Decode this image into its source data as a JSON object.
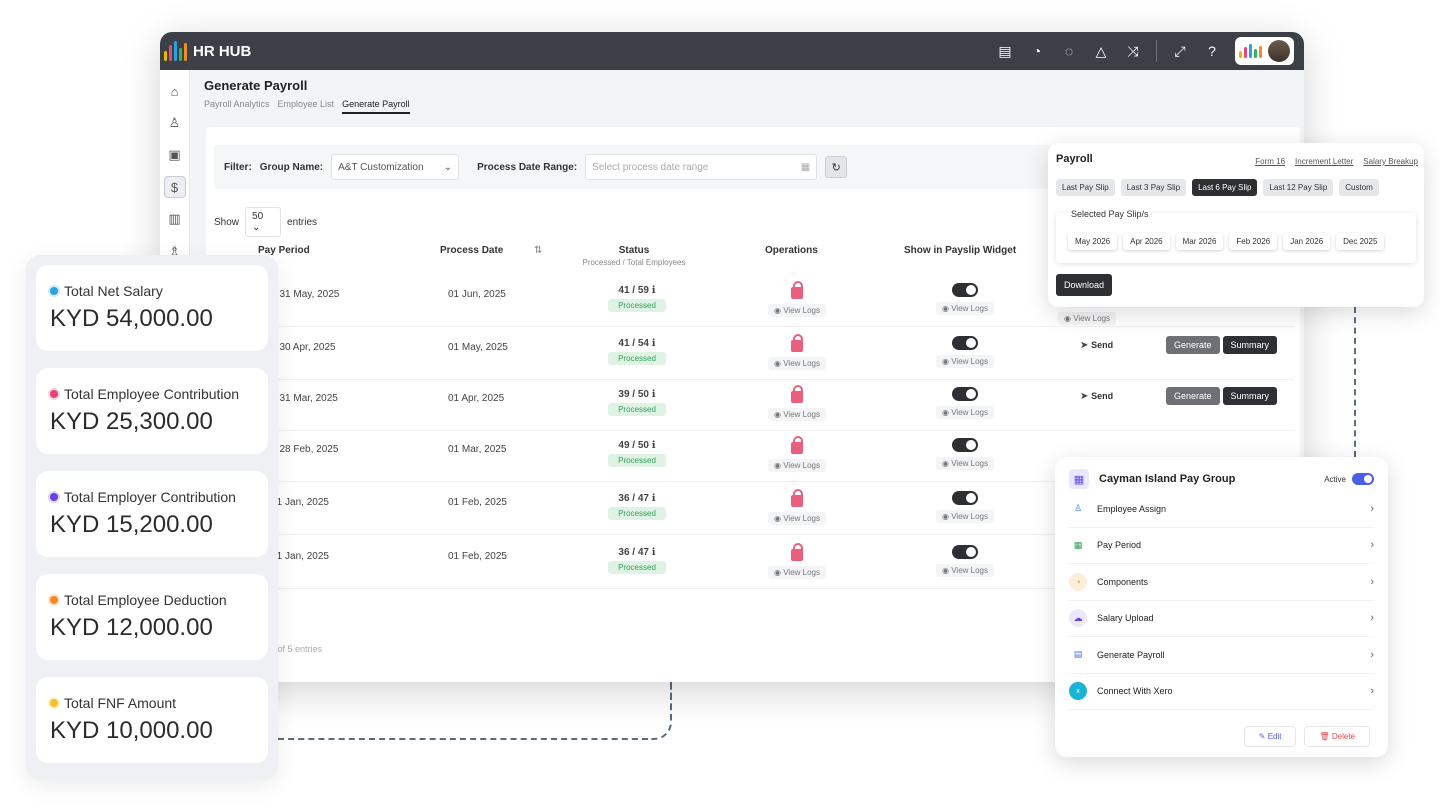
{
  "app": {
    "name": "HR HUB",
    "page_title": "Generate Payroll",
    "tabs": [
      "Payroll Analytics",
      "Employee List",
      "Generate Payroll"
    ]
  },
  "filter": {
    "label": "Filter:",
    "group_label": "Group Name:",
    "group_value": "A&T Customization",
    "date_label": "Process Date Range:",
    "date_placeholder": "Select process date range"
  },
  "show": {
    "before": "Show",
    "value": "50",
    "after": "entries"
  },
  "table": {
    "headers": {
      "period": "Pay Period",
      "process_date": "Process Date",
      "status": "Status",
      "status_sub": "Processed / Total Employees",
      "operations": "Operations",
      "widget": "Show in Payslip Widget"
    },
    "rows": [
      {
        "period": "5 to 31 May, 2025",
        "date": "01 Jun, 2025",
        "status": "41 / 59",
        "badge": "Processed",
        "logs": "View Logs",
        "logs2": "View Logs"
      },
      {
        "period": "5 to 30 Apr, 2025",
        "date": "01 May, 2025",
        "status": "41 / 54",
        "badge": "Processed",
        "logs": "View Logs",
        "logs2": "View Logs",
        "send": "Send",
        "gen": "Generate",
        "sum": "Summary"
      },
      {
        "period": "5 to 31 Mar, 2025",
        "date": "01 Apr, 2025",
        "status": "39 / 50",
        "badge": "Processed",
        "logs": "View Logs",
        "logs2": "View Logs",
        "send": "Send",
        "gen": "Generate",
        "sum": "Summary"
      },
      {
        "period": "5 to 28 Feb, 2025",
        "date": "01 Mar, 2025",
        "status": "49 / 50",
        "badge": "Processed",
        "logs": "View Logs",
        "logs2": "View Logs"
      },
      {
        "period": "to 31 Jan, 2025",
        "date": "01 Feb, 2025",
        "status": "36 / 47",
        "badge": "Processed",
        "logs": "View Logs",
        "logs2": "View Logs"
      },
      {
        "period": "to 31 Jan, 2025",
        "date": "01 Feb, 2025",
        "status": "36 / 47",
        "badge": "Processed",
        "logs": "View Logs",
        "logs2": "View Logs"
      }
    ],
    "extra_logs": "View Logs",
    "footer": "5 of 5 entries"
  },
  "stats": [
    {
      "label": "Total Net Salary",
      "value": "KYD 54,000.00",
      "color": "#2aa3e0"
    },
    {
      "label": "Total Employee Contribution",
      "value": "KYD 25,300.00",
      "color": "#e0427a"
    },
    {
      "label": "Total Employer Contribution",
      "value": "KYD 15,200.00",
      "color": "#6a3fe0"
    },
    {
      "label": "Total Employee Deduction",
      "value": "KYD 12,000.00",
      "color": "#f08a2a"
    },
    {
      "label": "Total FNF Amount",
      "value": "KYD 10,000.00",
      "color": "#f2c12a"
    }
  ],
  "payroll_popup": {
    "title": "Payroll",
    "links": [
      "Form 16",
      "Increment Letter",
      "Salary Breakup"
    ],
    "chips": [
      "Last Pay Slip",
      "Last 3 Pay Slip",
      "Last 6 Pay Slip",
      "Last 12 Pay Slip",
      "Custom"
    ],
    "selected_title": "Selected Pay Slip/s",
    "months": [
      "May 2026",
      "Apr 2026",
      "Mar 2026",
      "Feb 2026",
      "Jan 2026",
      "Dec 2025"
    ],
    "download": "Download"
  },
  "pay_group": {
    "title": "Cayman Island Pay Group",
    "active": "Active",
    "items": [
      "Employee Assign",
      "Pay Period",
      "Components",
      "Salary Upload",
      "Generate Payroll",
      "Connect With Xero"
    ],
    "edit": "Edit",
    "delete": "Delete"
  }
}
